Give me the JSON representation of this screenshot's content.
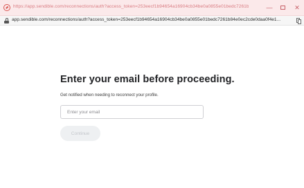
{
  "window": {
    "title": "https://app.sendible.com/reconnections/auth?access_token=253eecf1b94654a16904cb34be0a0855e01bedc7261b84e0ec2cde0daa0f4...",
    "controls": {
      "minimize": "—",
      "maximize": "",
      "close": "✕"
    },
    "accent_color": "#d9534f"
  },
  "address_bar": {
    "url": "app.sendible.com/reconnections/auth?access_token=253eecf1b94654a16904cb34be0a0855e01bedc7261b84e0ec2cde0daa0f4e1..."
  },
  "page": {
    "heading": "Enter your email before proceeding.",
    "subtext": "Get notified when needing to reconnect your profile.",
    "email": {
      "placeholder": "Enter your email",
      "value": ""
    },
    "continue_label": "Continue"
  }
}
